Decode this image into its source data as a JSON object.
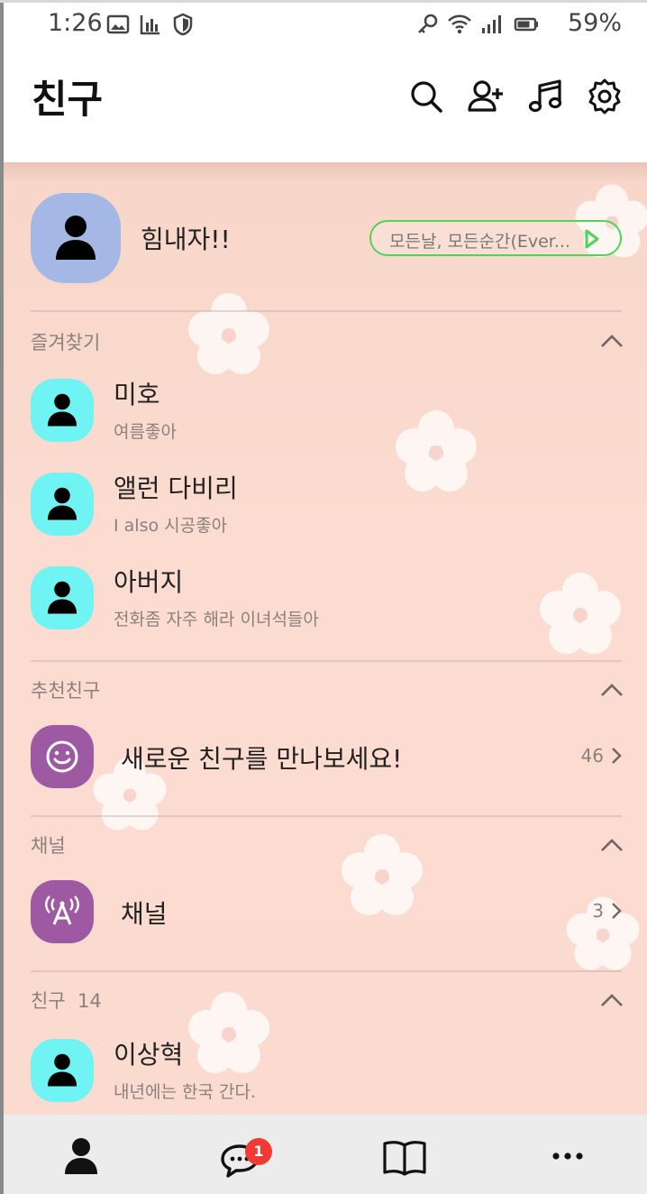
{
  "status_bar": {
    "time": "1:26",
    "battery": "59%"
  },
  "header": {
    "title": "친구"
  },
  "profile": {
    "name": "힘내자!!",
    "music": "모든날, 모든순간(Ever..."
  },
  "favorites": {
    "title": "즐겨찾기",
    "items": [
      {
        "name": "미호",
        "status": "여름좋아"
      },
      {
        "name": "앨런 다비리",
        "status": "I also 시공좋아"
      },
      {
        "name": "아버지",
        "status": "전화좀 자주 해라 이녀석들아"
      }
    ]
  },
  "recommend": {
    "title": "추천친구",
    "item": {
      "label": "새로운 친구를 만나보세요!",
      "count": "46"
    }
  },
  "channel": {
    "title": "채널",
    "item": {
      "label": "채널",
      "count": "3"
    }
  },
  "friends": {
    "title": "친구",
    "count": "14",
    "items": [
      {
        "name": "이상혁",
        "status": "내년에는 한국 간다."
      }
    ]
  },
  "bottom_nav": {
    "chat_badge": "1"
  },
  "colors": {
    "accent_green": "#4ed45a",
    "avatar_cyan": "#6ff3f3",
    "purple": "#9d5aa3",
    "background_pink": "#fbdbcf",
    "badge_red": "#f03a33"
  },
  "icons": [
    "image-icon",
    "chart-icon",
    "shield-icon",
    "key-icon",
    "wifi-icon",
    "signal-icon",
    "battery-icon",
    "search-icon",
    "add-friend-icon",
    "music-icon",
    "settings-icon",
    "person-icon",
    "chat-icon",
    "book-icon",
    "more-icon"
  ]
}
